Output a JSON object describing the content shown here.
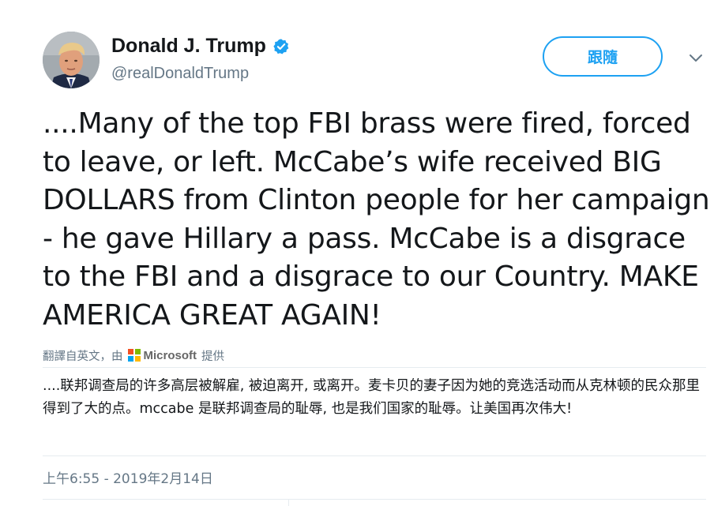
{
  "author": {
    "display_name": "Donald J. Trump",
    "handle": "@realDonaldTrump",
    "verified": true,
    "avatar_icon": "profile-photo"
  },
  "header": {
    "follow_label": "跟隨",
    "menu_icon": "chevron-down-icon"
  },
  "tweet": {
    "text": "....Many of the top FBI brass were fired, forced to leave, or left. McCabe’s wife received BIG DOLLARS from Clinton people for her campaign - he gave Hillary a pass. McCabe is a disgrace to the FBI and a disgrace to our Country. MAKE AMERICA GREAT AGAIN!",
    "timestamp": "上午6:55 - 2019年2月14日"
  },
  "translation": {
    "prefix": "翻譯自英文，由",
    "provider": "Microsoft",
    "suffix": "提供",
    "text": "....联邦调查局的许多高层被解雇, 被迫离开, 或离开。麦卡贝的妻子因为她的竞选活动而从克林顿的民众那里得到了大的点。mccabe 是联邦调查局的耻辱, 也是我们国家的耻辱。让美国再次伟大!"
  },
  "colors": {
    "accent": "#1da1f2",
    "text_primary": "#14171a",
    "text_secondary": "#657786",
    "divider": "#e6ecf0",
    "ms_red": "#f25022",
    "ms_green": "#7fba00",
    "ms_blue": "#00a4ef",
    "ms_yellow": "#ffb900"
  }
}
